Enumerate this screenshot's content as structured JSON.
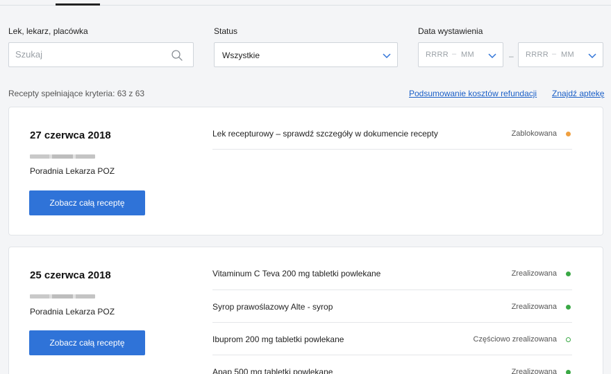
{
  "filters": {
    "search_label": "Lek, lekarz, placówka",
    "search_placeholder": "Szukaj",
    "status_label": "Status",
    "status_value": "Wszystkie",
    "date_label": "Data wystawienia",
    "date_from_year": "RRRR",
    "date_from_month": "MM",
    "date_to_year": "RRRR",
    "date_to_month": "MM",
    "date_range_separator": "–",
    "date_part_separator": "–"
  },
  "results": {
    "count_text": "Recepty spełniające kryteria: 63 z 63",
    "link_summary": "Podsumowanie kosztów refundacji",
    "link_pharmacy": "Znajdź aptekę"
  },
  "prescriptions": [
    {
      "date": "27 czerwca 2018",
      "clinic": "Poradnia Lekarza POZ",
      "button_label": "Zobacz całą receptę",
      "medicines": [
        {
          "name": "Lek recepturowy – sprawdź szczegóły w dokumencie recepty",
          "status": "Zablokowana",
          "status_color": "#f0a040"
        }
      ]
    },
    {
      "date": "25 czerwca 2018",
      "clinic": "Poradnia Lekarza POZ",
      "button_label": "Zobacz całą receptę",
      "medicines": [
        {
          "name": "Vitaminum C Teva 200 mg tabletki powlekane",
          "status": "Zrealizowana",
          "status_color": "#3aa845"
        },
        {
          "name": "Syrop prawoślazowy Alte - syrop",
          "status": "Zrealizowana",
          "status_color": "#3aa845"
        },
        {
          "name": "Ibuprom 200 mg tabletki powlekane",
          "status": "Częściowo zrealizowana",
          "status_color": "#3aa845"
        },
        {
          "name": "Apap 500 mg tabletki powlekane",
          "status": "Zrealizowana",
          "status_color": "#3aa845"
        }
      ]
    }
  ],
  "icons": {
    "search": "search-icon",
    "dropdown": "chevron-down-icon",
    "status_blocked": "status-dot-orange",
    "status_done": "status-dot-green",
    "status_partial": "status-dot-green-outline"
  }
}
